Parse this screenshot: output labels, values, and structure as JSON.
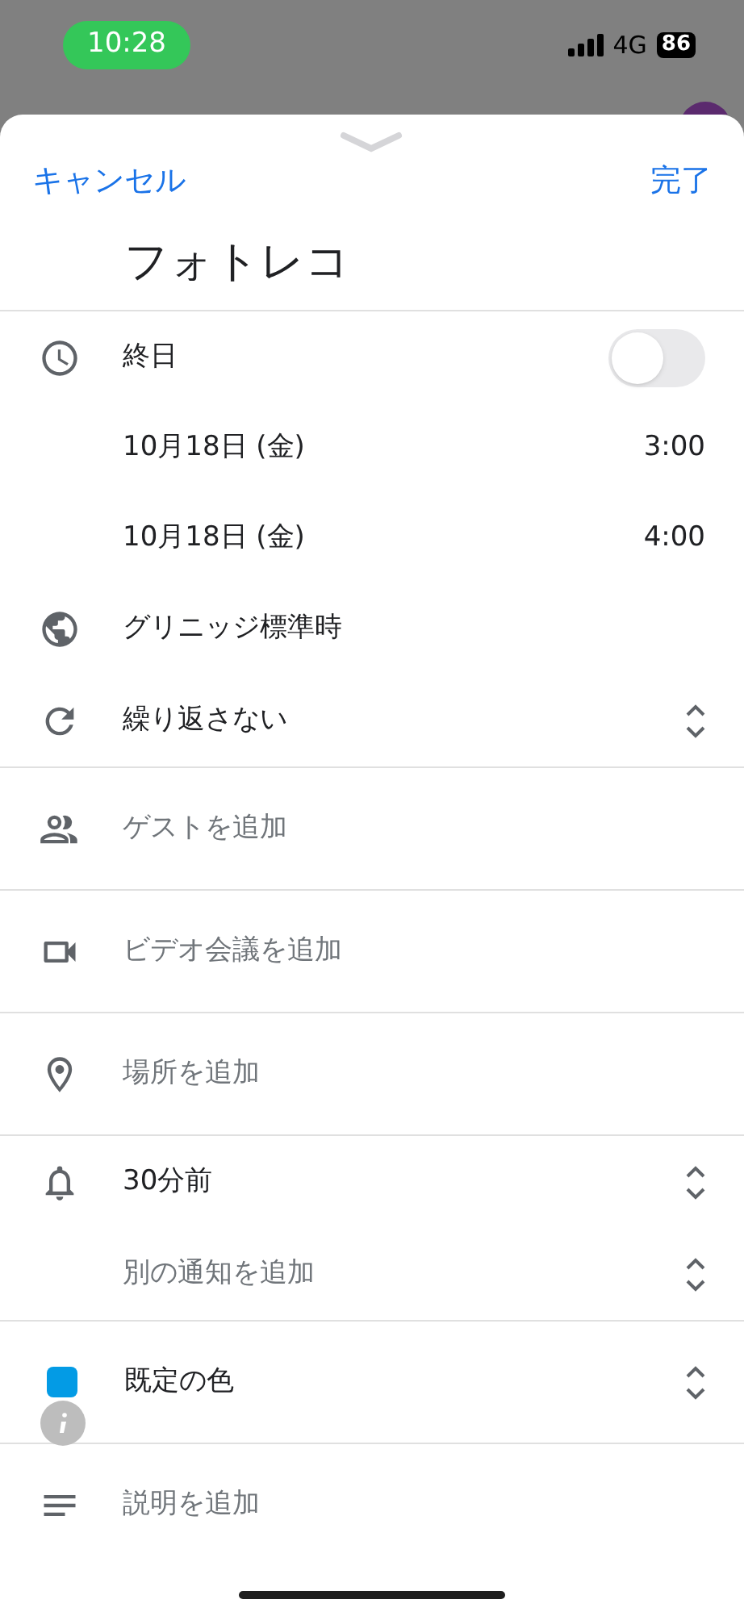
{
  "status_bar": {
    "time": "10:28",
    "network": "4G",
    "battery": "86"
  },
  "header": {
    "cancel": "キャンセル",
    "done": "完了"
  },
  "title": "フォトレコ",
  "sections": [
    {
      "rows": [
        {
          "kind": "toggle",
          "label": "終日",
          "on": false
        },
        {
          "kind": "datetime",
          "date": "10月18日 (金)",
          "time": "3:00"
        },
        {
          "kind": "datetime",
          "date": "10月18日 (金)",
          "time": "4:00"
        },
        {
          "kind": "plain",
          "label": "グリニッジ標準時"
        },
        {
          "kind": "select",
          "label": "繰り返さない"
        }
      ]
    },
    {
      "rows": [
        {
          "kind": "hint",
          "label": "ゲストを追加"
        }
      ]
    },
    {
      "rows": [
        {
          "kind": "hint",
          "label": "ビデオ会議を追加"
        }
      ]
    },
    {
      "rows": [
        {
          "kind": "hint",
          "label": "場所を追加"
        }
      ]
    },
    {
      "rows": [
        {
          "kind": "select",
          "label": "30分前"
        },
        {
          "kind": "hint-select",
          "label": "別の通知を追加"
        }
      ]
    },
    {
      "rows": [
        {
          "kind": "color",
          "label": "既定の色",
          "color": "#039be5"
        }
      ]
    },
    {
      "rows": [
        {
          "kind": "hint",
          "label": "説明を追加"
        }
      ]
    }
  ]
}
